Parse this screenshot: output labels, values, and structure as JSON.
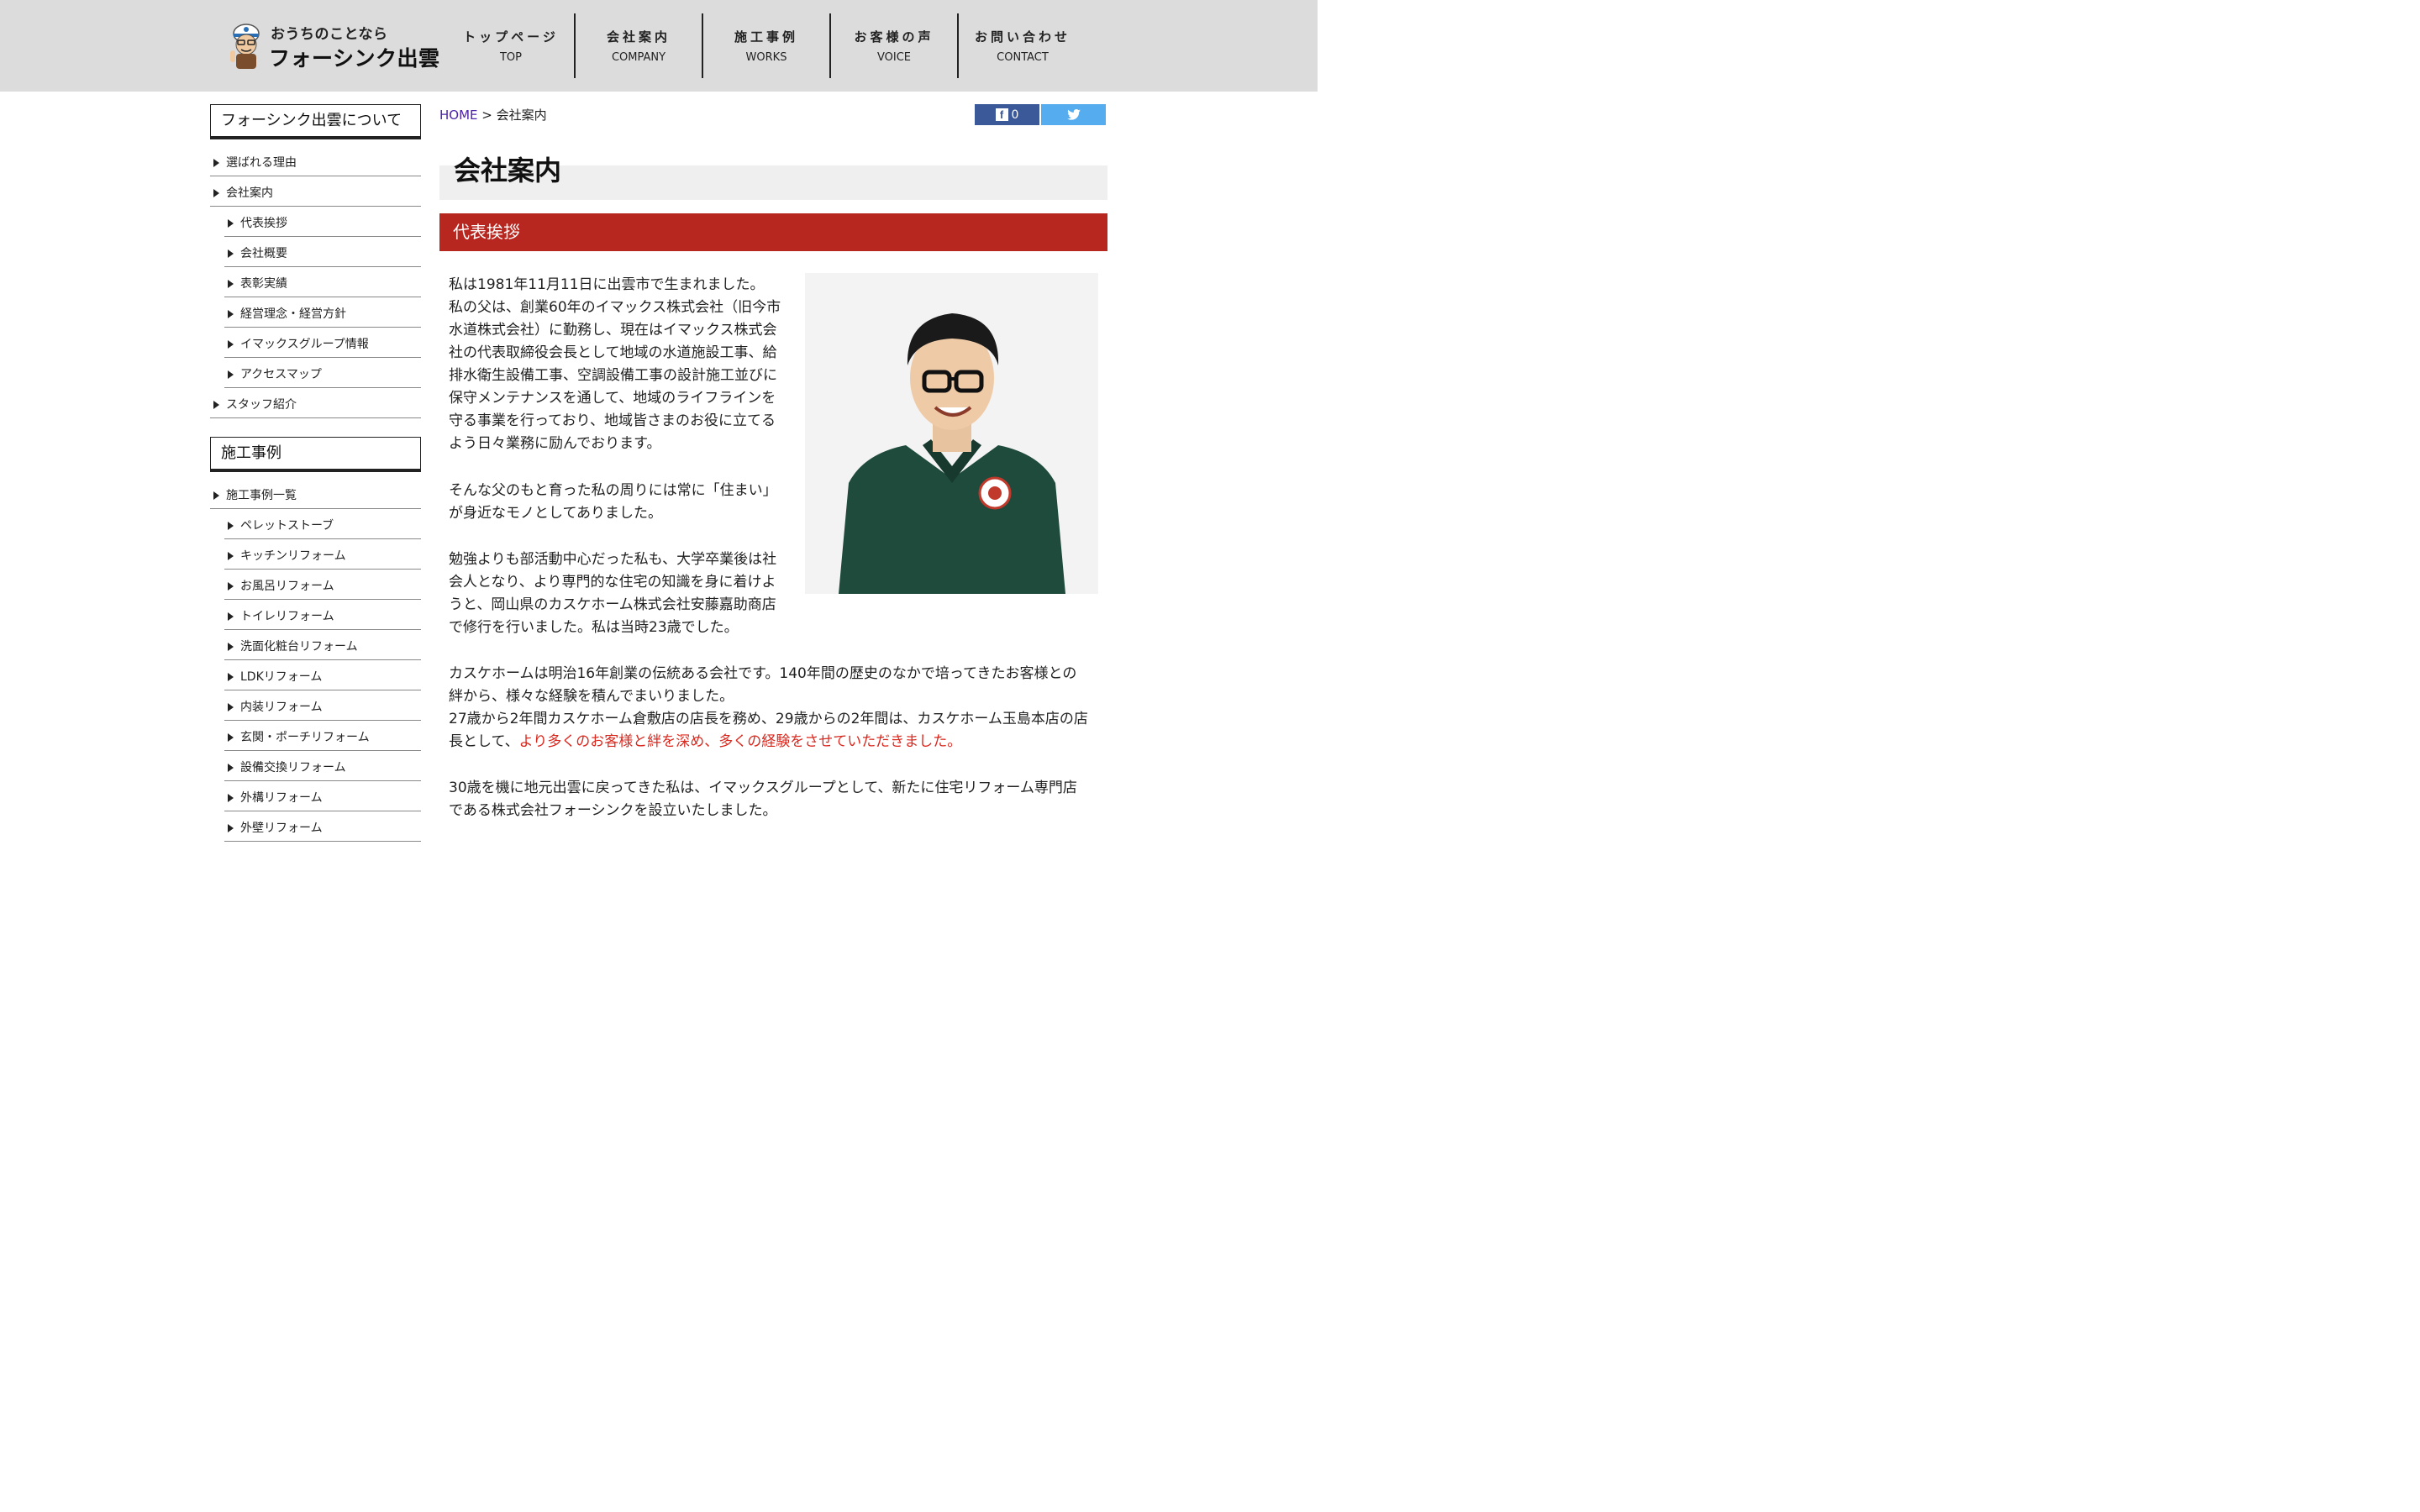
{
  "header": {
    "logo_tagline": "おうちのことなら",
    "logo_name": "フォーシンク出雲",
    "nav": [
      {
        "jp": "トップページ",
        "en": "TOP"
      },
      {
        "jp": "会社案内",
        "en": "COMPANY"
      },
      {
        "jp": "施工事例",
        "en": "WORKS"
      },
      {
        "jp": "お客様の声",
        "en": "VOICE"
      },
      {
        "jp": "お問い合わせ",
        "en": "CONTACT"
      }
    ]
  },
  "sidebar": {
    "section1_title": "フォーシンク出雲について",
    "section1_items": [
      {
        "label": "選ばれる理由"
      },
      {
        "label": "会社案内"
      },
      {
        "label": "代表挨拶"
      },
      {
        "label": "会社概要"
      },
      {
        "label": "表彰実績"
      },
      {
        "label": "経営理念・経営方針"
      },
      {
        "label": "イマックスグループ情報"
      },
      {
        "label": "アクセスマップ"
      },
      {
        "label": "スタッフ紹介"
      }
    ],
    "section2_title": "施工事例",
    "section2_items": [
      {
        "label": "施工事例一覧"
      },
      {
        "label": "ペレットストーブ"
      },
      {
        "label": "キッチンリフォーム"
      },
      {
        "label": "お風呂リフォーム"
      },
      {
        "label": "トイレリフォーム"
      },
      {
        "label": "洗面化粧台リフォーム"
      },
      {
        "label": "LDKリフォーム"
      },
      {
        "label": "内装リフォーム"
      },
      {
        "label": "玄関・ポーチリフォーム"
      },
      {
        "label": "設備交換リフォーム"
      },
      {
        "label": "外構リフォーム"
      },
      {
        "label": "外壁リフォーム"
      }
    ]
  },
  "breadcrumb": {
    "home": "HOME",
    "separator": ">",
    "current": "会社案内"
  },
  "share": {
    "fb_count": "0"
  },
  "page_title": "会社案内",
  "section_title": "代表挨拶",
  "colors": {
    "header_bg": "#dcdcdc",
    "section_bar": "#b7261f",
    "accent_text": "#d9291f",
    "link": "#4b22a8",
    "facebook": "#3b5998",
    "twitter": "#55acee"
  },
  "body": {
    "p1": [
      "私は1981年11月11日に出雲市で生まれました。",
      "私の父は、創業60年のイマックス株式会社（旧今市",
      "水道株式会社）に勤務し、現在はイマックス株式会",
      "社の代表取締役会長として地域の水道施設工事、給",
      "排水衛生設備工事、空調設備工事の設計施工並びに",
      "保守メンテナンスを通して、地域のライフラインを",
      "守る事業を行っており、地域皆さまのお役に立てる",
      "よう日々業務に励んでおります。"
    ],
    "p2": [
      "そんな父のもと育った私の周りには常に「住まい」",
      "が身近なモノとしてありました。"
    ],
    "p3": [
      "勉強よりも部活動中心だった私も、大学卒業後は社",
      "会人となり、より専門的な住宅の知識を身に着けよ",
      "うと、岡山県のカスケホーム株式会社安藤嘉助商店",
      "で修行を行いました。私は当時23歳でした。"
    ],
    "p4_line1": "カスケホームは明治16年創業の伝統ある会社です。140年間の歴史のなかで培ってきたお客様との",
    "p4_line2": "絆から、様々な経験を積んでまいりました。",
    "p4_line3": "27歳から2年間カスケホーム倉敷店の店長を務め、29歳からの2年間は、カスケホーム玉島本店の店",
    "p4_line4_prefix": "長として、",
    "p4_line4_accent": "より多くのお客様と絆を深め、多くの経験をさせていただきました。",
    "p5_line1": "30歳を機に地元出雲に戻ってきた私は、イマックスグループとして、新たに住宅リフォーム専門店",
    "p5_line2": "である株式会社フォーシンクを設立いたしました。"
  }
}
